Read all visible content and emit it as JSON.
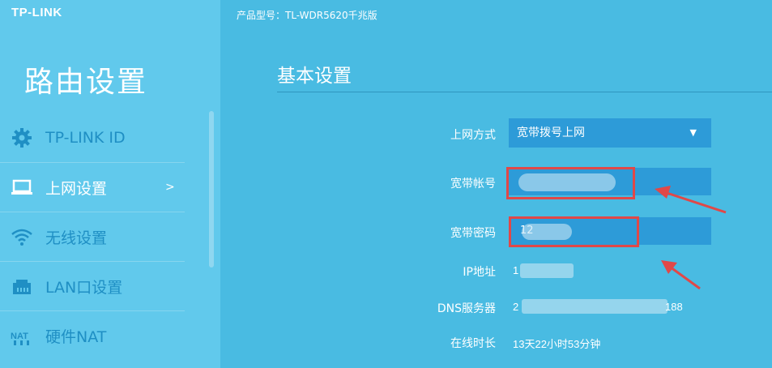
{
  "brand": {
    "logo": "TP-LINK"
  },
  "sidebar": {
    "title": "路由设置",
    "items": [
      {
        "label": "TP-LINK ID",
        "icon": "gear-icon"
      },
      {
        "label": "上网设置",
        "icon": "laptop-icon",
        "arrow": ">"
      },
      {
        "label": "无线设置",
        "icon": "wifi-icon"
      },
      {
        "label": "LAN口设置",
        "icon": "ethernet-icon"
      },
      {
        "label": "硬件NAT",
        "icon": "nat-icon"
      }
    ]
  },
  "main": {
    "model": "产品型号：TL-WDR5620千兆版",
    "title": "基本设置",
    "fields": {
      "connection_type_label": "上网方式",
      "connection_type_value": "宽带拨号上网",
      "account_label": "宽带帐号",
      "password_label": "宽带密码",
      "password_value": "12",
      "ip_label": "IP地址",
      "ip_value": "1",
      "dns_label": "DNS服务器",
      "dns_value_start": "2",
      "dns_value_end": "188",
      "uptime_label": "在线时长",
      "uptime_value": "13天22小时53分钟"
    }
  },
  "colors": {
    "sidebar_bg": "#61c9ec",
    "main_bg": "#49bbe2",
    "input_bg": "#2d9bd8",
    "annotation_red": "#e04848"
  }
}
